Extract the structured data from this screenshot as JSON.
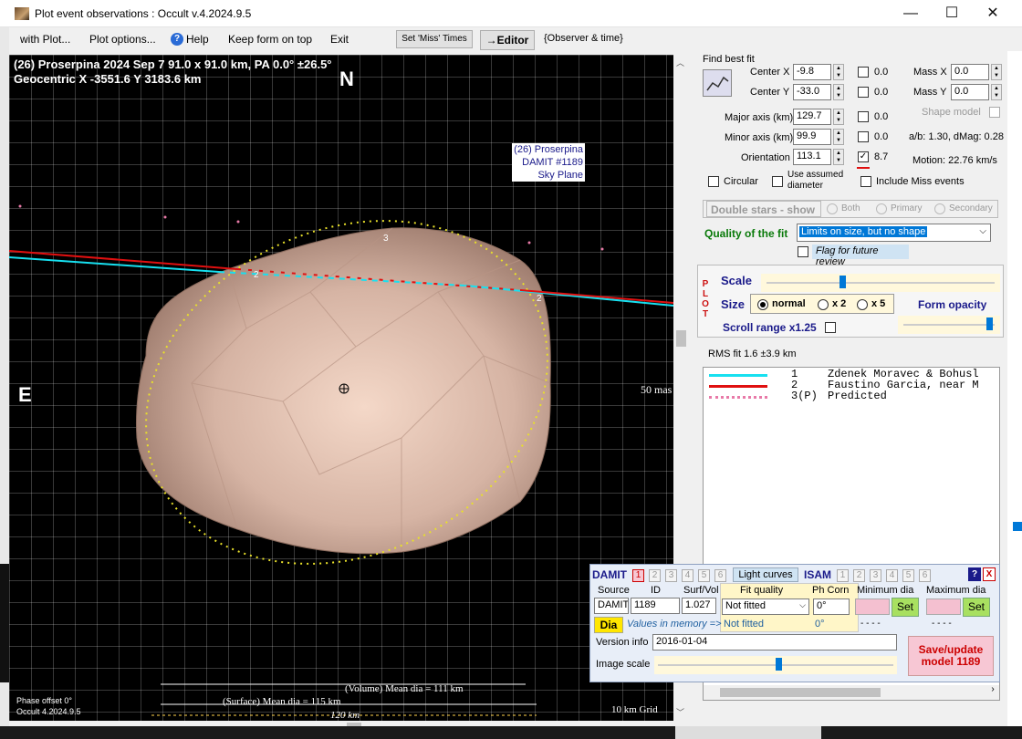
{
  "window": {
    "title": "Plot event observations : Occult v.4.2024.9.5",
    "minimize": "—",
    "maximize": "☐",
    "close": "✕"
  },
  "menu": {
    "with_plot": "with Plot...",
    "plot_options": "Plot options...",
    "help": "Help",
    "keep_on_top": "Keep form on top",
    "exit": "Exit",
    "set_miss": "Set 'Miss' Times",
    "editor": "→Editor",
    "observer_time": "{Observer & time}"
  },
  "plot": {
    "title_line1": "(26) Proserpina  2024 Sep 7  91.0 x 91.0 km, PA 0.0° ±26.5°",
    "title_line2": "Geocentric  X  -3551.6  Y  3183.6 km",
    "north": "N",
    "east": "E",
    "label_box": [
      "(26) Proserpina",
      "DAMIT #1189",
      "Sky Plane"
    ],
    "scale_50mas": "50 mas",
    "volume_dia": "(Volume) Mean dia = 111 km",
    "surface_dia": "(Surface) Mean dia = 115 km",
    "scale_120": "120 km",
    "grid": "10 km Grid",
    "phase_offset": "Phase offset 0°",
    "version": "Occult 4.2024.9.5",
    "chord_labels": [
      "2",
      "2",
      "3"
    ]
  },
  "fit": {
    "find_best_fit": "Find best fit",
    "center_x_label": "Center X",
    "center_x": "-9.8",
    "center_y_label": "Center Y",
    "center_y": "-33.0",
    "major_label": "Major axis (km)",
    "major": "129.7",
    "minor_label": "Minor axis (km)",
    "minor": "99.9",
    "orient_label": "Orientation",
    "orient": "113.1",
    "v1": "0.0",
    "v2": "0.0",
    "v3": "0.0",
    "v4": "0.0",
    "v5": "8.7",
    "mass_x_label": "Mass X",
    "mass_x": "0.0",
    "mass_y_label": "Mass Y",
    "mass_y": "0.0",
    "shape_model": "Shape model",
    "ab": "a/b: 1.30, dMag: 0.28",
    "motion": "Motion: 22.76 km/s",
    "circular": "Circular",
    "use_assumed": "Use assumed",
    "diameter": "diameter",
    "include_miss": "Include Miss events"
  },
  "double": {
    "title": "Double stars - show",
    "both": "Both",
    "primary": "Primary",
    "secondary": "Secondary"
  },
  "quality": {
    "label": "Quality of the fit",
    "value": "Limits on size, but no shape",
    "flag": "Flag for future review"
  },
  "plotsec": {
    "vertical": "P L O T",
    "scale": "Scale",
    "size": "Size",
    "normal": "normal",
    "x2": "x 2",
    "x5": "x 5",
    "form_opacity": "Form opacity",
    "scroll_range": "Scroll range x1.25",
    "scale_slider_pct": 0.32,
    "opacity_slider_pct": 0.95
  },
  "rms": "RMS fit  1.6 ±3.9 km",
  "legend": [
    {
      "num": "1",
      "name": "Zdenek Moravec & Bohusl",
      "color": "#17e0f0",
      "style": "solid"
    },
    {
      "num": "2",
      "name": "Faustino Garcia, near M",
      "color": "#e01010",
      "style": "solid"
    },
    {
      "num": "3(P)",
      "name": "Predicted",
      "color": "#e87aa8",
      "style": "dots"
    }
  ],
  "damit": {
    "damit": "DAMIT",
    "tabs": [
      "1",
      "2",
      "3",
      "4",
      "5",
      "6"
    ],
    "light_curves": "Light curves",
    "isam": "ISAM",
    "isam_tabs": [
      "1",
      "2",
      "3",
      "4",
      "5",
      "6"
    ],
    "help": "?",
    "close": "X",
    "source_label": "Source",
    "id_label": "ID",
    "surf_label": "Surf/Vol",
    "fit_quality_label": "Fit quality",
    "ph_corr_label": "Ph Corn",
    "min_dia_label": "Minimum dia",
    "max_dia_label": "Maximum dia",
    "source": "DAMIT",
    "id": "1189",
    "surf": "1.027",
    "fit_quality": "Not fitted",
    "ph_corr": "0°",
    "set": "Set",
    "dia": "Dia",
    "values_mem": "Values in memory =>",
    "mem_fit": "Not fitted",
    "mem_ph": "0°",
    "dashes": "- - - -",
    "version_label": "Version info",
    "version": "2016-01-04",
    "image_scale": "Image scale",
    "save": "Save/update model  1189",
    "image_scale_pct": 0.5
  }
}
